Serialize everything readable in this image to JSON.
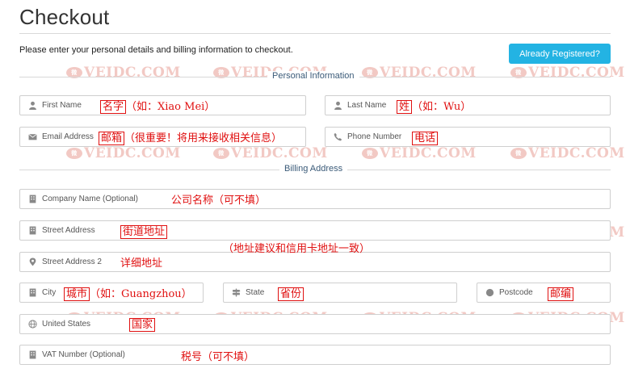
{
  "page": {
    "title": "Checkout",
    "intro": "Please enter your personal details and billing information to checkout.",
    "already_registered": "Already Registered?"
  },
  "sections": {
    "personal": "Personal Information",
    "billing": "Billing Address"
  },
  "fields": {
    "first_name": "First Name",
    "last_name": "Last Name",
    "email": "Email Address",
    "phone": "Phone Number",
    "company": "Company Name (Optional)",
    "street1": "Street Address",
    "street2": "Street Address 2",
    "city": "City",
    "state": "State",
    "postcode": "Postcode",
    "country": "United States",
    "vat": "VAT Number (Optional)"
  },
  "annotations": {
    "first_name_box": "名字",
    "first_name_note": "（如：Xiao Mei）",
    "last_name_box": "姓",
    "last_name_note": "（如：Wu）",
    "email_box": "邮箱",
    "email_note": "（很重要！将用来接收相关信息）",
    "phone_box": "电话",
    "company": "公司名称（可不填）",
    "street1_box": "街道地址",
    "street_note": "（地址建议和信用卡地址一致）",
    "street2": "详细地址",
    "city_box": "城市",
    "city_note": "（如：Guangzhou）",
    "state_box": "省份",
    "postcode_box": "邮编",
    "country_box": "国家",
    "vat": "税号（可不填）"
  },
  "watermark": {
    "text": "VEIDC.COM",
    "logo": "微"
  },
  "icons": {
    "first_name": "user-icon",
    "last_name": "user-icon",
    "email": "envelope-icon",
    "phone": "phone-icon",
    "company": "building-icon",
    "street1": "building-icon",
    "street2": "map-marker-icon",
    "city": "building-icon",
    "state": "signpost-icon",
    "postcode": "circle-icon",
    "country": "globe-icon",
    "vat": "building-icon"
  },
  "colors": {
    "button": "#23b3e3",
    "annotation": "#e01010",
    "section_title": "#3a5a78",
    "watermark": "#f2c9c4"
  }
}
